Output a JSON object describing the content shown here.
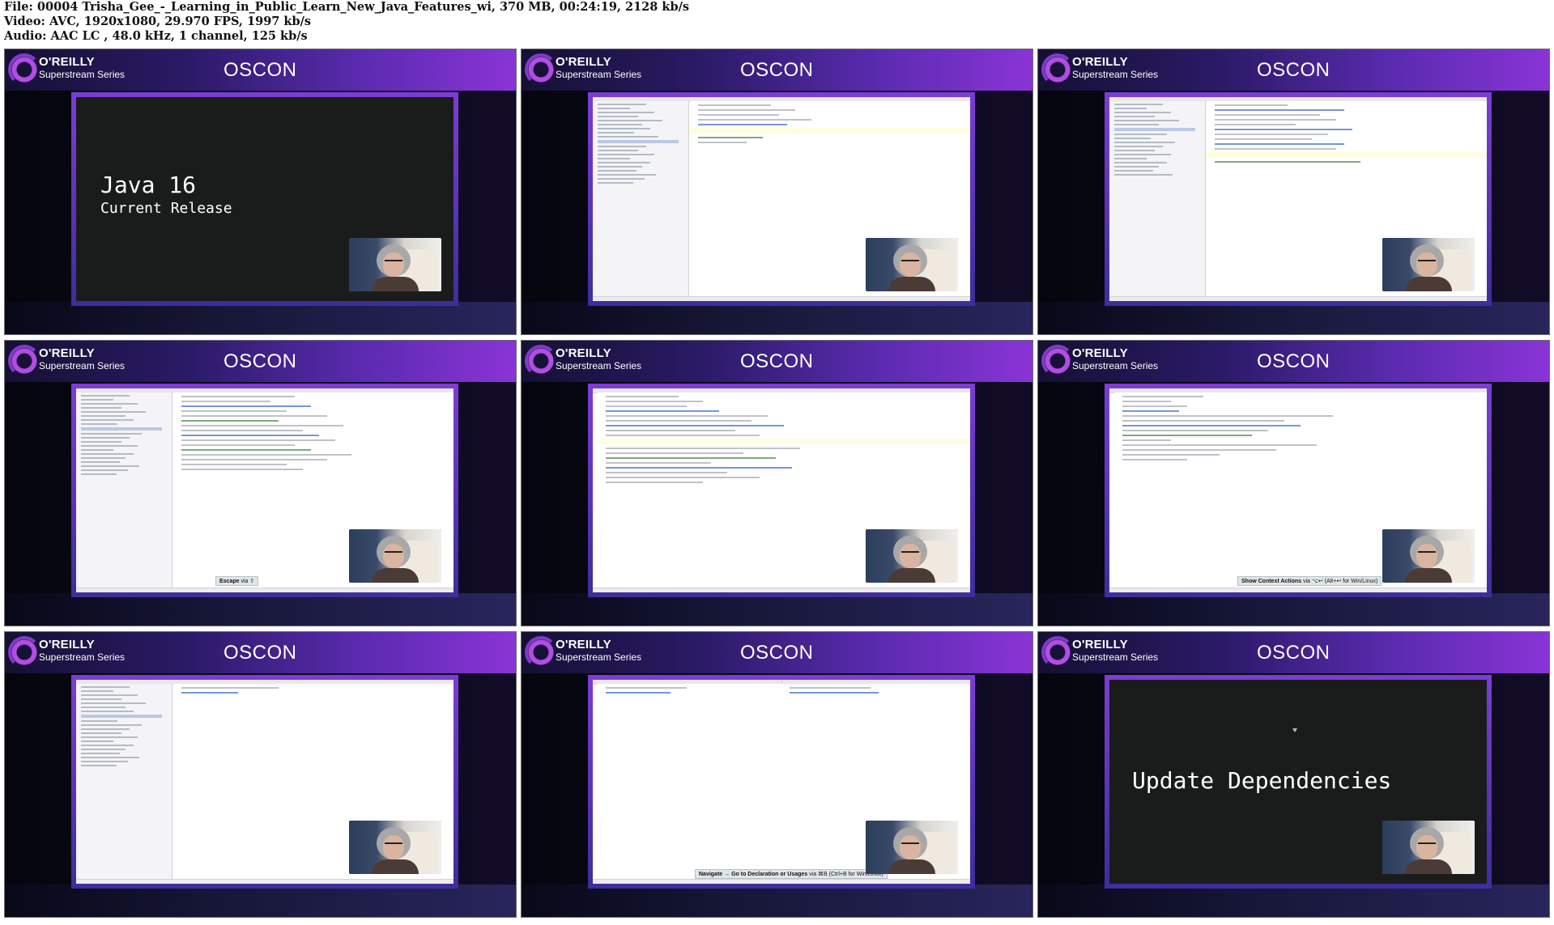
{
  "header": {
    "line1": "File: 00004 Trisha_Gee_-_Learning_in_Public_Learn_New_Java_Features_wi, 370 MB, 00:24:19, 2128 kb/s",
    "line2": "Video: AVC, 1920x1080, 29.970 FPS, 1997 kb/s",
    "line3": "Audio: AAC LC , 48.0 kHz, 1 channel, 125 kb/s"
  },
  "brand": {
    "name": "O'REILLY",
    "series": "Superstream Series",
    "event": "OSCON"
  },
  "tiles": [
    {
      "kind": "slide",
      "title": "Java 16",
      "subtitle": "Current Release"
    },
    {
      "kind": "ide"
    },
    {
      "kind": "ide"
    },
    {
      "kind": "ide",
      "tooltip_key": "Escape",
      "tooltip_rest": " via ⇧"
    },
    {
      "kind": "ide"
    },
    {
      "kind": "ide",
      "tooltip_key": "Show Context Actions",
      "tooltip_rest": " via ⌥↩ (Alt+↩ for Win/Linux)"
    },
    {
      "kind": "ide"
    },
    {
      "kind": "ide-split",
      "tooltip_key": "Navigate → Go to Declaration or Usages",
      "tooltip_rest": " via ⌘B (Ctrl+B for Win/Linux)"
    },
    {
      "kind": "slide",
      "title": "Update Dependencies",
      "subtitle": ""
    }
  ],
  "colors": {
    "banner_start": "#151033",
    "banner_end": "#8a34d6",
    "frame": "#7c3dd4",
    "slide_bg": "#1a1c1c"
  },
  "icons": [
    "oreilly-logo-icon",
    "webcam-feed"
  ]
}
